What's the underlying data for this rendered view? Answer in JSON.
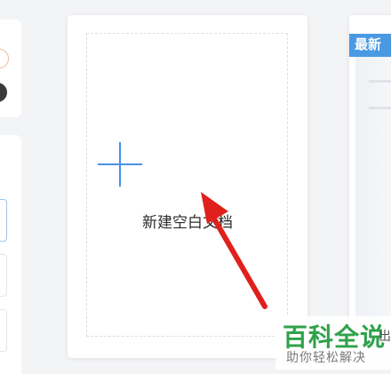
{
  "template_card": {
    "new_blank_doc_label": "新建空白文档",
    "plus_icon": "plus-icon",
    "accent_color": "#4a8ee8"
  },
  "next_card": {
    "badge": "最新",
    "badge_color": "#4a9ae3"
  },
  "watermark": {
    "title": "百科全说",
    "partial_text": "出",
    "subtitle": "助你轻松解决",
    "color": "#2fa24a"
  },
  "annotation": {
    "arrow_color": "#e0201c"
  }
}
